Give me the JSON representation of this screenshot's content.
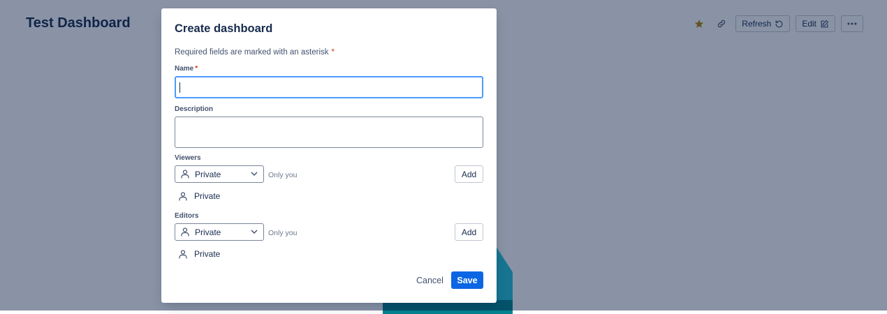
{
  "page": {
    "title": "Test Dashboard",
    "toolbar": {
      "refresh_label": "Refresh",
      "edit_label": "Edit",
      "star_color": "#b38600"
    }
  },
  "modal": {
    "title": "Create dashboard",
    "required_note": "Required fields are marked with an asterisk",
    "required_mark": "*",
    "name": {
      "label": "Name",
      "value": "",
      "placeholder": ""
    },
    "description": {
      "label": "Description",
      "value": "",
      "placeholder": ""
    },
    "viewers": {
      "label": "Viewers",
      "selected": "Private",
      "hint": "Only you",
      "add_label": "Add",
      "items": [
        {
          "icon": "person-icon",
          "label": "Private"
        }
      ]
    },
    "editors": {
      "label": "Editors",
      "selected": "Private",
      "hint": "Only you",
      "add_label": "Add",
      "items": [
        {
          "icon": "person-icon",
          "label": "Private"
        }
      ]
    },
    "footer": {
      "cancel_label": "Cancel",
      "save_label": "Save"
    }
  },
  "colors": {
    "primary": "#0c66e4",
    "focus": "#4c9aff",
    "required": "#de350b"
  }
}
